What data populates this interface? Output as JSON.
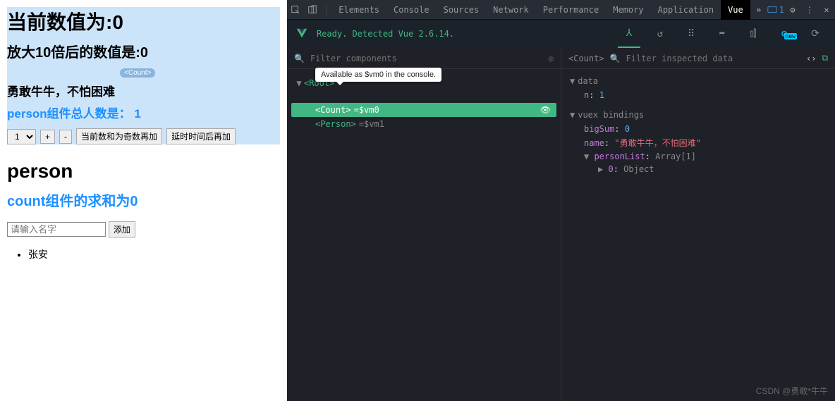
{
  "left": {
    "heading_current": "当前数值为:0",
    "heading_times10": "放大10倍后的数值是:0",
    "badge": "<Count>",
    "brave_text": "勇敢牛牛，不怕困难",
    "person_total": "person组件总人数是： 1",
    "select_value": "1",
    "btn_plus": "+",
    "btn_minus": "-",
    "btn_odd": "当前数和为奇数再加",
    "btn_delay": "延时时间后再加",
    "person_title": "person",
    "count_sum": "count组件的求和为0",
    "name_placeholder": "请输入名字",
    "btn_add": "添加",
    "list_item_0": "张安"
  },
  "tabs": {
    "elements": "Elements",
    "console": "Console",
    "sources": "Sources",
    "network": "Network",
    "performance": "Performance",
    "memory": "Memory",
    "application": "Application",
    "vue": "Vue",
    "msg_count": "1"
  },
  "vue": {
    "status": "Ready. Detected Vue 2.6.14.",
    "new_badge": "new",
    "filter_components": "Filter components",
    "filter_inspected": "Filter inspected data",
    "tooltip": "Available as $vm0 in the console.",
    "tree": {
      "root": "<Root>",
      "count": "<Count>",
      "count_var": "$vm0",
      "person": "<Person>",
      "person_var": "$vm1"
    },
    "inspector": {
      "component": "<Count>",
      "data_section": "data",
      "n_key": "n",
      "n_val": "1",
      "vuex_section": "vuex bindings",
      "bigSum_key": "bigSum",
      "bigSum_val": "0",
      "name_key": "name",
      "name_val": "\"勇敢牛牛，不怕困难\"",
      "personList_key": "personList",
      "personList_val": "Array[1]",
      "p0_key": "0",
      "p0_val": "Object"
    }
  },
  "watermark": "CSDN @勇敢*牛牛"
}
